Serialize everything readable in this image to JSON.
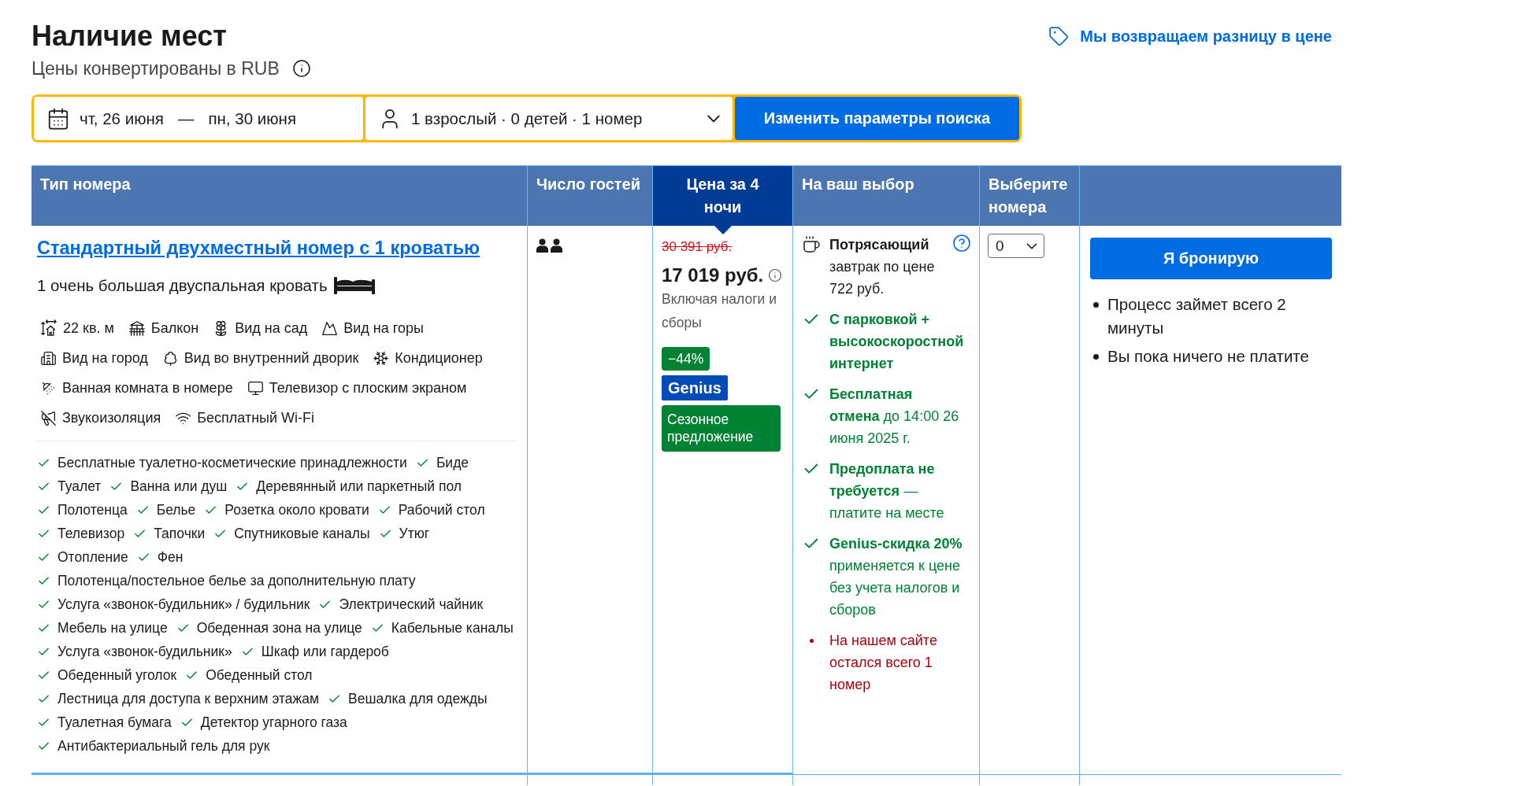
{
  "header": {
    "title": "Наличие мест",
    "subtitle": "Цены конвертированы в RUB",
    "price_match_link": "Мы возвращаем разницу в цене"
  },
  "search_bar": {
    "check_in": "чт, 26 июня",
    "date_separator": "—",
    "check_out": "пн, 30 июня",
    "guests": "1 взрослый · 0 детей · 1 номер",
    "button": "Изменить параметры поиска"
  },
  "table": {
    "columns": [
      {
        "label": "Тип номера",
        "highlighted": false
      },
      {
        "label": "Число гостей",
        "highlighted": false
      },
      {
        "label": "Цена за 4 ночи",
        "highlighted": true
      },
      {
        "label": "На ваш выбор",
        "highlighted": false
      },
      {
        "label": "Выберите номера",
        "highlighted": false
      },
      {
        "highlighted": false
      }
    ],
    "rows": [
      {
        "name": "Стандартный двухместный номер с 1 кроватью",
        "beds": "1 очень большая двуспальная кровать",
        "facilities": [
          [
            "22 кв. м",
            "Балкон",
            "Вид на сад",
            "Вид на горы"
          ],
          [
            "Вид на город",
            "Вид во внутренний дворик",
            "Кондиционер"
          ],
          [
            "Ванная комната в номере",
            "Телевизор с плоским экраном"
          ],
          [
            "Звукоизоляция",
            "Бесплатный Wi-Fi"
          ]
        ],
        "amenities": [
          [
            "Бесплатные туалетно-косметические принадлежности",
            "Биде"
          ],
          [
            "Туалет",
            "Ванна или душ",
            "Деревянный или паркетный пол"
          ],
          [
            "Полотенца",
            "Белье",
            "Розетка около кровати",
            "Рабочий стол"
          ],
          [
            "Телевизор",
            "Тапочки",
            "Спутниковые каналы",
            "Утюг"
          ],
          [
            "Отопление",
            "Фен"
          ],
          [
            "Полотенца/постельное белье за дополнительную плату"
          ],
          [
            "Услуга «звонок-будильник» / будильник",
            "Электрический чайник"
          ],
          [
            "Мебель на улице",
            "Обеденная зона на улице",
            "Кабельные каналы"
          ],
          [
            "Услуга «звонок-будильник»",
            "Шкаф или гардероб"
          ],
          [
            "Обеденный уголок",
            "Обеденный стол"
          ],
          [
            "Лестница для доступа к верхним этажам",
            "Вешалка для одежды"
          ],
          [
            "Туалетная бумага",
            "Детектор угарного газа"
          ],
          [
            "Антибактериальный гель для рук"
          ]
        ],
        "price": {
          "old": "30 391 руб.",
          "current": "17 019 руб.",
          "note": "Включая налоги и сборы",
          "badges": [
            {
              "kind": "discount",
              "text": "−44%"
            },
            {
              "kind": "genius",
              "text": "Genius"
            },
            {
              "kind": "deal",
              "text": "Сезонное предложение"
            }
          ]
        },
        "choices": [
          {
            "kind": "breakfast",
            "title": "Потрясающий",
            "detail": "завтрак по цене 722 руб."
          },
          {
            "kind": "check",
            "title": "С парковкой + высокоскоростной интернет"
          },
          {
            "kind": "check",
            "title": "Бесплатная отмена",
            "detail": "до 14:00 26 июня 2025 г."
          },
          {
            "kind": "check",
            "title": "Предоплата не требуется",
            "detail": "— платите на месте"
          },
          {
            "kind": "check",
            "title": "Genius-скидка 20%",
            "detail": "применяется к цене без учета налогов и сборов"
          },
          {
            "kind": "warning",
            "detail": "На нашем сайте остался всего 1 номер"
          }
        ],
        "quantity": "0",
        "book_button": "Я бронирую",
        "notes": [
          "Процесс займет всего 2 минуты",
          "Вы пока ничего не платите"
        ]
      }
    ]
  }
}
